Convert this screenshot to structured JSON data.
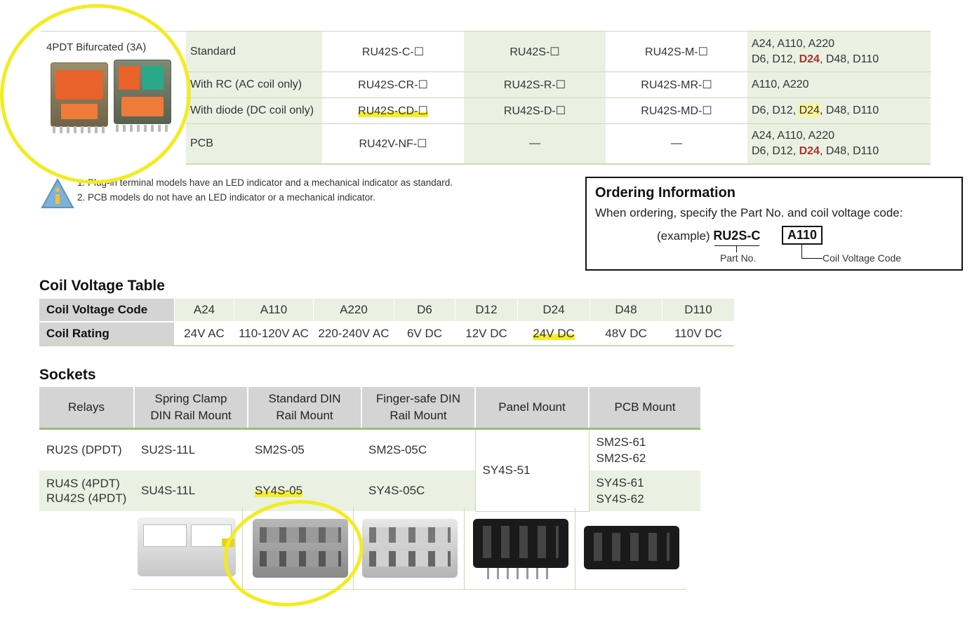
{
  "product": {
    "name": "4PDT Bifurcated (3A)",
    "rows": [
      {
        "type": "Standard",
        "c1": "RU42S-C-☐",
        "c2": "RU42S-☐",
        "c3": "RU42S-M-☐",
        "v1": "A24, A110, A220",
        "v2a": "D6, D12, ",
        "v2b": "D24",
        "v2c": ", D48, D110"
      },
      {
        "type": "With RC (AC coil only)",
        "c1": "RU42S-CR-☐",
        "c2": "RU42S-R-☐",
        "c3": "RU42S-MR-☐",
        "v1": "A110, A220"
      },
      {
        "type": "With diode (DC coil only)",
        "c1": "RU42S-CD-☐",
        "c2": "RU42S-D-☐",
        "c3": "RU42S-MD-☐",
        "v1a": "D6, D12, ",
        "v1b": "D24",
        "v1c": ", D48, D110"
      },
      {
        "type": "PCB",
        "c1": "RU42V-NF-☐",
        "c2": "—",
        "c3": "—",
        "v1": "A24, A110, A220",
        "v2a": "D6, D12, ",
        "v2b": "D24",
        "v2c": ", D48, D110"
      }
    ]
  },
  "notes": [
    "1.  Plug-in terminal models have an LED indicator and a mechanical indicator as standard.",
    "2.  PCB models do not have an LED indicator or a mechanical indicator."
  ],
  "ordering": {
    "title": "Ordering Information",
    "text": "When ordering, specify the Part No. and coil voltage code:",
    "example_label": "(example) ",
    "part": "RU2S-C",
    "code": "A110",
    "part_label": "Part No.",
    "code_label": "Coil Voltage Code"
  },
  "coil_table": {
    "title": "Coil Voltage Table",
    "row1_label": "Coil Voltage Code",
    "row2_label": "Coil Rating",
    "codes": [
      "A24",
      "A110",
      "A220",
      "D6",
      "D12",
      "D24",
      "D48",
      "D110"
    ],
    "ratings": [
      "24V AC",
      "110-120V AC",
      "220-240V AC",
      "6V DC",
      "12V DC",
      "24V DC",
      "48V DC",
      "110V DC"
    ]
  },
  "sockets": {
    "title": "Sockets",
    "headers": [
      "Relays",
      "Spring Clamp\nDIN Rail Mount",
      "Standard DIN\nRail Mount",
      "Finger-safe DIN\nRail Mount",
      "Panel Mount",
      "PCB Mount"
    ],
    "row1": {
      "relay": "RU2S (DPDT)",
      "spring": "SU2S-11L",
      "std": "SM2S-05",
      "finger": "SM2S-05C",
      "pcb1": "SM2S-61",
      "pcb2": "SM2S-62"
    },
    "row2": {
      "relay1": "RU4S (4PDT)",
      "relay2": "RU42S (4PDT)",
      "spring": "SU4S-11L",
      "std": "SY4S-05",
      "finger": "SY4S-05C",
      "pcb1": "SY4S-61",
      "pcb2": "SY4S-62"
    },
    "panel": "SY4S-51"
  },
  "colors": {
    "highlight": "#f2ec1e",
    "accent_red": "#b0302a",
    "table_green": "#eaf1e2"
  }
}
